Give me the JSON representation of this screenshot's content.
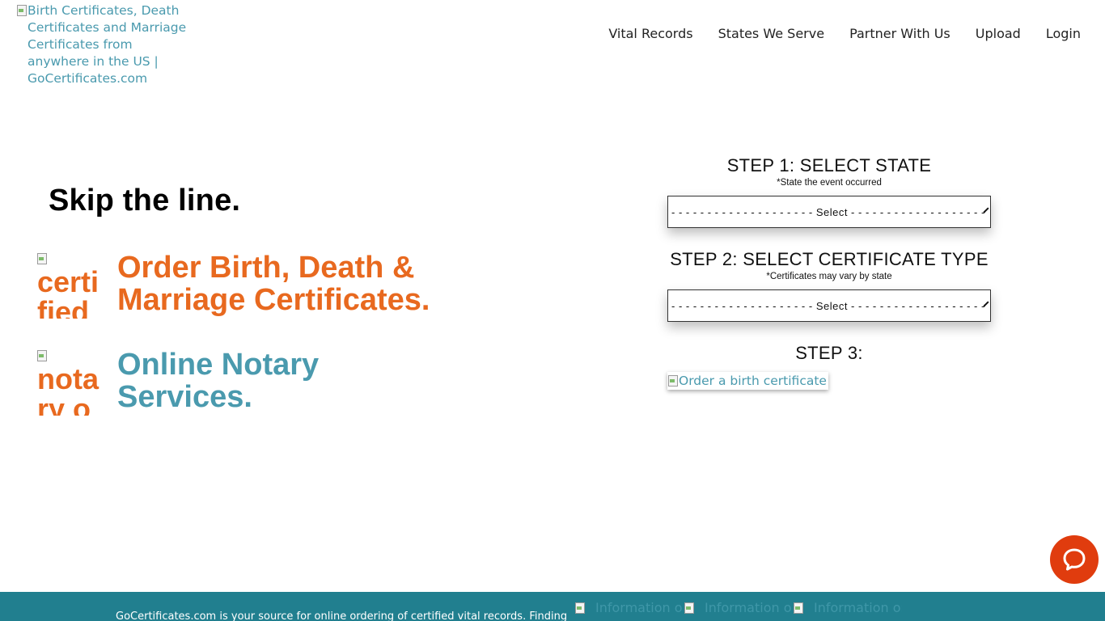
{
  "header": {
    "logo_alt": "Birth Certificates, Death Certificates and Marriage Certificates from anywhere in the US | GoCertificates.com",
    "nav": [
      "Vital Records",
      "States We Serve",
      "Partner With Us",
      "Upload",
      "Login"
    ]
  },
  "hero": {
    "headline": "Skip the line.",
    "services": [
      {
        "icon_alt": "certified copies",
        "title": "Order Birth, Death &\nMarriage Certificates."
      },
      {
        "icon_alt": "notary online",
        "title": "Online Notary\nServices."
      }
    ]
  },
  "order_form": {
    "step1": {
      "title": "STEP 1: SELECT STATE",
      "subtitle": "*State the event occurred",
      "selected": "- - - - - - - - - - - - - - - - - - - - Select - - - - - - - - - - - - - - - - - - -"
    },
    "step2": {
      "title": "STEP 2: SELECT CERTIFICATE TYPE",
      "subtitle": "*Certificates may vary by state",
      "selected": "- - - - - - - - - - - - - - - - - - - - Select - - - - - - - - - - - - - - - - - - -"
    },
    "step3": {
      "title": "STEP 3:",
      "button_alt": "Order a birth certificate"
    }
  },
  "chat": {
    "icon": "chat-bubble-icon"
  },
  "footer": {
    "text": "GoCertificates.com is your source for online ordering of certified vital records. Finding",
    "links": [
      "Information on",
      "Information on",
      "Information on"
    ]
  },
  "colors": {
    "teal": "#4a9aae",
    "orange": "#e8691f",
    "footer_bg": "#217f8f",
    "chat_bg": "#e03c0e"
  }
}
